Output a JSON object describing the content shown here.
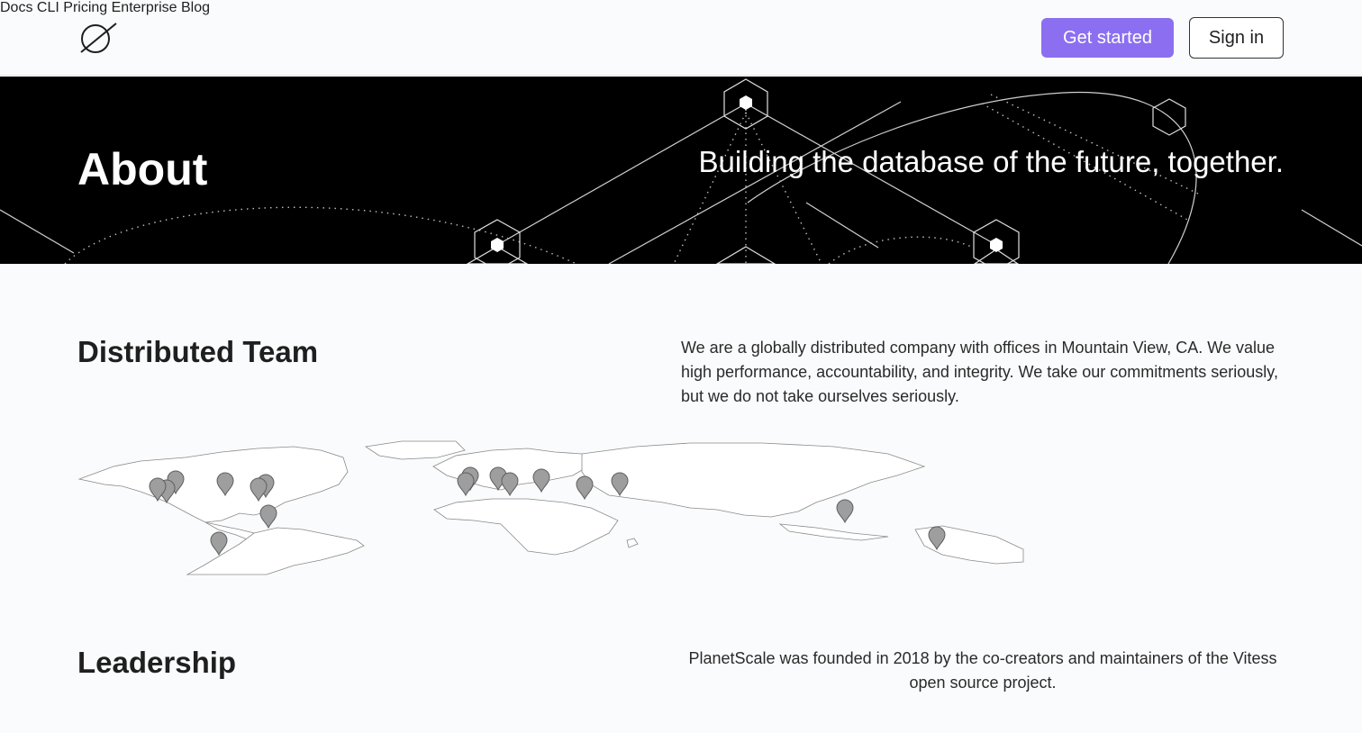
{
  "header": {
    "logo": "planetscale-logo",
    "nav": [
      {
        "label": "Docs"
      },
      {
        "label": "CLI"
      },
      {
        "label": "Pricing"
      },
      {
        "label": "Enterprise"
      },
      {
        "label": "Blog"
      }
    ],
    "cta_primary": "Get started",
    "cta_secondary": "Sign in",
    "primary_color": "#8c6ff0"
  },
  "hero": {
    "title": "About",
    "tagline": "Building the database of the future, together."
  },
  "distributed_team": {
    "title": "Distributed Team",
    "text": "We are a globally distributed company with offices in Mountain View, CA. We value high performance, accountability, and integrity. We take our commitments seriously, but we do not take ourselves seriously."
  },
  "leadership": {
    "title": "Leadership",
    "text": "PlanetScale was founded in 2018 by the co-creators and maintainers of the Vitess open source project."
  }
}
